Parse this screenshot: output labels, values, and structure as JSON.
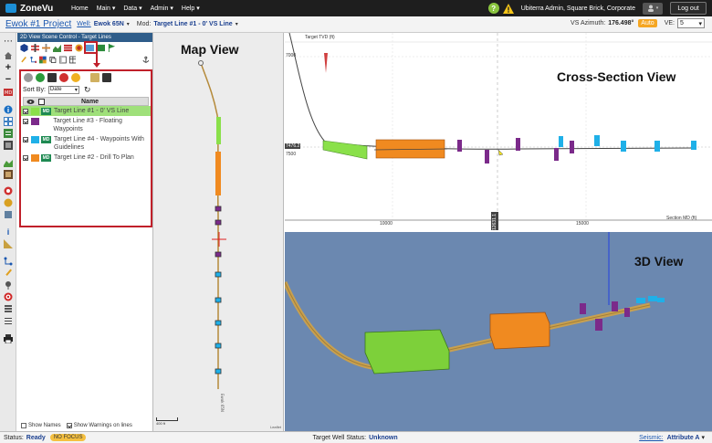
{
  "nav": {
    "logo": "ZoneVu",
    "items": [
      "Home",
      "Main",
      "Data",
      "Admin",
      "Help"
    ],
    "user": "Ubiterra Admin, Square Brick, Corporate",
    "logout": "Log out"
  },
  "project": {
    "name": "Ewok #1 Project",
    "well_label": "Well:",
    "well_value": "Ewok 65N",
    "mod_label": "Mod:",
    "mod_value": "Target Line #1 - 0' VS Line",
    "vs_label": "VS Azimuth:",
    "vs_value": "176.498°",
    "auto": "Auto",
    "ve_label": "VE:",
    "ve_value": "5"
  },
  "scene_control": {
    "title": "2D View Scene Control - Target Lines",
    "sort_label": "Sort By:",
    "sort_value": "Date",
    "header_name": "Name",
    "rows": [
      {
        "name": "Target Line #1 - 0' VS Line",
        "color": "#8ae04a",
        "badge": "MD",
        "selected": true
      },
      {
        "name": "Target Line #3 - Floating Waypoints",
        "color": "#7b2a8a",
        "badge": "",
        "selected": false
      },
      {
        "name": "Target Line #4 - Waypoints With Guidelines",
        "color": "#1fb0e8",
        "badge": "MD",
        "selected": false
      },
      {
        "name": "Target Line #2 - Drill To Plan",
        "color": "#f08a20",
        "badge": "MD",
        "selected": false
      }
    ],
    "show_names": "Show Names",
    "show_warnings": "Show Warnings on lines"
  },
  "map": {
    "title": "Map View",
    "scale": "400 ft",
    "leaflet": "Leaflet"
  },
  "cross_section": {
    "title": "Cross-Section View",
    "y_label": "Target TVD (ft)",
    "y_ticks": [
      "7000",
      "7500"
    ],
    "y_marker": "7476.2",
    "x_label": "Section MD (ft)",
    "x_ticks": [
      "10000",
      "15000"
    ],
    "x_marker": "12631.1"
  },
  "view3d": {
    "title": "3D View"
  },
  "status": {
    "status_label": "Status:",
    "status_value": "Ready",
    "focus": "NO FOCUS",
    "well_status_label": "Target Well Status:",
    "well_status_value": "Unknown",
    "seismic_label": "Seismic:",
    "seismic_value": "Attribute A"
  }
}
